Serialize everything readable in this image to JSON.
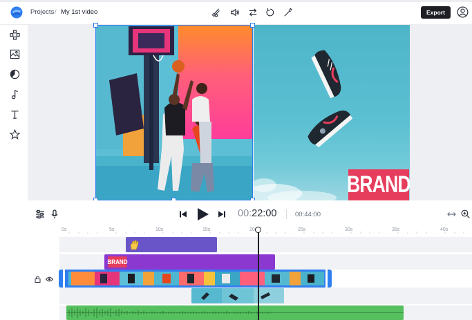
{
  "breadcrumb": {
    "projects": "Projects",
    "separator": "/",
    "project_title": "My 1st video"
  },
  "toolbar": {
    "icons": [
      "scissors-icon",
      "volume-icon",
      "swap-icon",
      "rotate-icon",
      "magic-wand-icon"
    ],
    "export_label": "Export"
  },
  "sidebar": {
    "items": [
      "layout-grid-icon",
      "media-gallery-icon",
      "color-palette-icon",
      "music-note-icon",
      "text-icon",
      "star-icon"
    ]
  },
  "preview": {
    "brand_overlay": "BRAND",
    "brand_color": "#e63d5d",
    "selection_color": "#2f7ff0"
  },
  "playback": {
    "current_time_hours": "00:",
    "current_time_rest": "22:00",
    "total_duration": "00:44:00"
  },
  "timeline": {
    "ruler_labels": [
      "0s",
      "5s",
      "10s",
      "15s",
      "20s",
      "25s",
      "30s",
      "35s",
      "40s"
    ],
    "playhead_position_seconds": 20.5,
    "tracks": [
      {
        "type": "sticker",
        "color": "#6a55c8"
      },
      {
        "type": "logo",
        "label": "BRAND",
        "color": "#8a38d0"
      },
      {
        "type": "video",
        "color": "#2f7ff0"
      },
      {
        "type": "video-overlay",
        "color": "#7fc9d8"
      },
      {
        "type": "audio",
        "color": "#56c05f"
      }
    ]
  }
}
